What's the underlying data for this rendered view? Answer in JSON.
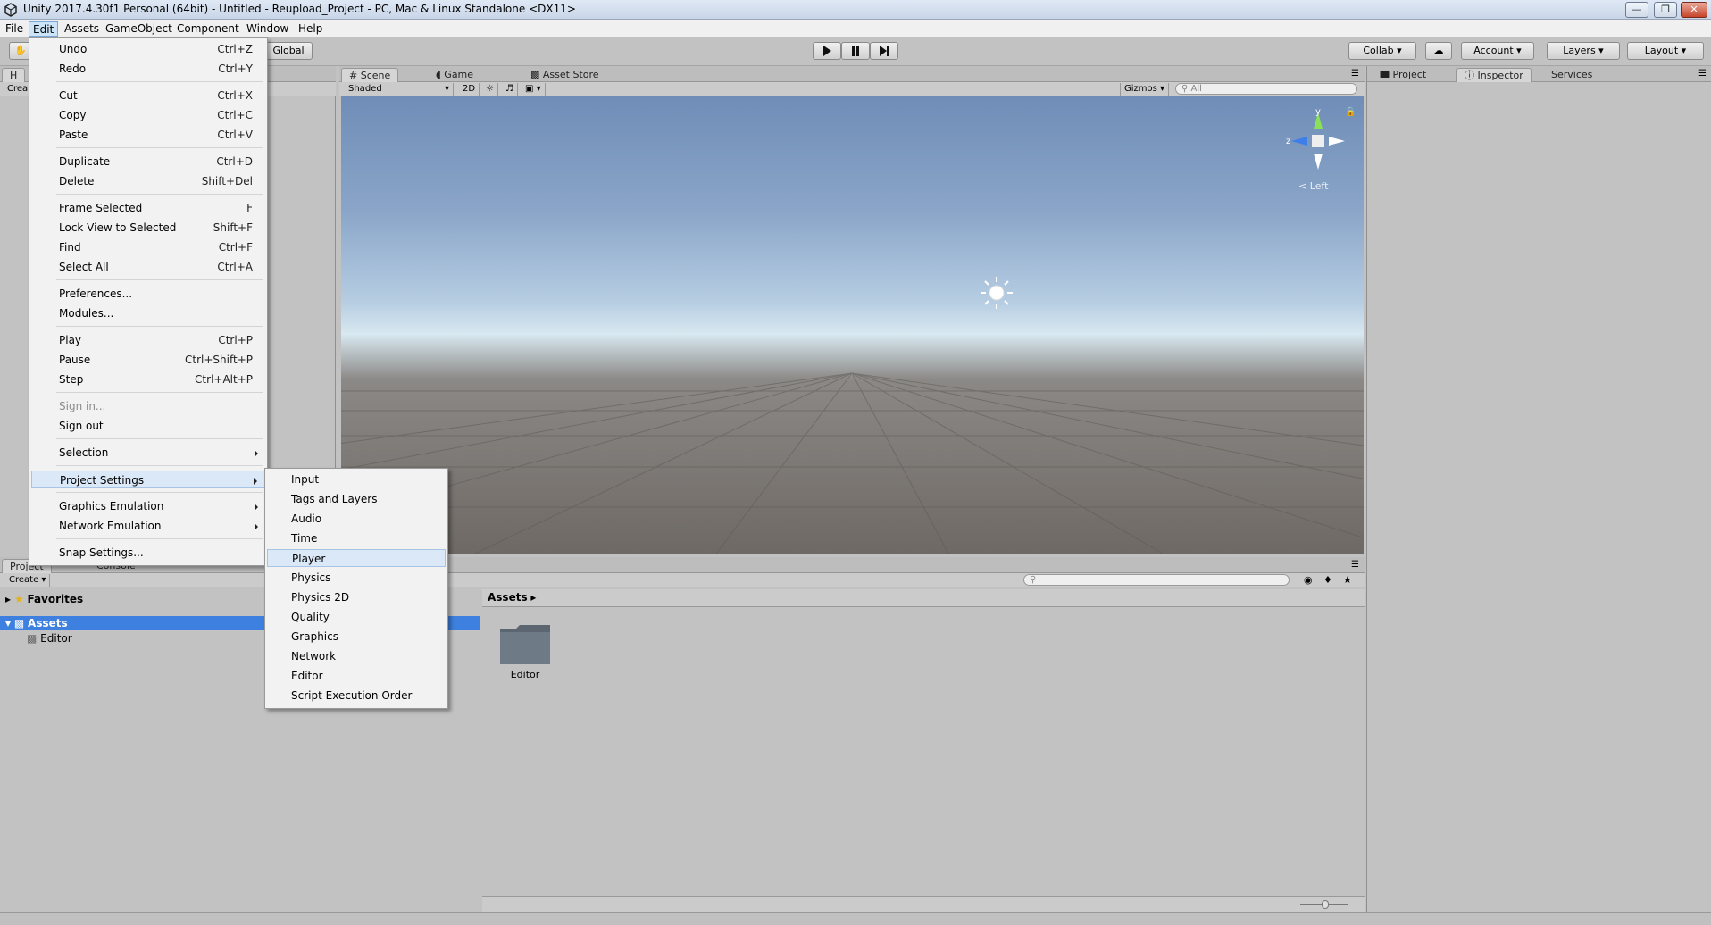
{
  "window": {
    "title": "Unity 2017.4.30f1 Personal (64bit) - Untitled - Reupload_Project - PC, Mac & Linux Standalone <DX11>"
  },
  "menubar": {
    "items": [
      "File",
      "Edit",
      "Assets",
      "GameObject",
      "Component",
      "Window",
      "Help"
    ]
  },
  "toolbar": {
    "global_label": "Global",
    "collab_label": "Collab",
    "account_label": "Account",
    "layers_label": "Layers",
    "layout_label": "Layout"
  },
  "scene_tabs": [
    "Scene",
    "Game",
    "Asset Store"
  ],
  "scene_toolbar": {
    "shading": "Shaded",
    "mode_2d": "2D",
    "gizmos": "Gizmos",
    "search_placeholder": "All"
  },
  "gizmo": {
    "label": "< Left",
    "y_axis": "y",
    "z_axis": "z"
  },
  "right_tabs": [
    "Project",
    "Inspector",
    "Services"
  ],
  "hierarchy": {
    "tab": "H",
    "create": "Crea"
  },
  "edit_menu": [
    {
      "label": "Undo",
      "shortcut": "Ctrl+Z"
    },
    {
      "label": "Redo",
      "shortcut": "Ctrl+Y"
    },
    {
      "label": "Cut",
      "shortcut": "Ctrl+X"
    },
    {
      "label": "Copy",
      "shortcut": "Ctrl+C"
    },
    {
      "label": "Paste",
      "shortcut": "Ctrl+V"
    },
    {
      "label": "Duplicate",
      "shortcut": "Ctrl+D"
    },
    {
      "label": "Delete",
      "shortcut": "Shift+Del"
    },
    {
      "label": "Frame Selected",
      "shortcut": "F"
    },
    {
      "label": "Lock View to Selected",
      "shortcut": "Shift+F"
    },
    {
      "label": "Find",
      "shortcut": "Ctrl+F"
    },
    {
      "label": "Select All",
      "shortcut": "Ctrl+A"
    },
    {
      "label": "Preferences...",
      "shortcut": ""
    },
    {
      "label": "Modules...",
      "shortcut": ""
    },
    {
      "label": "Play",
      "shortcut": "Ctrl+P"
    },
    {
      "label": "Pause",
      "shortcut": "Ctrl+Shift+P"
    },
    {
      "label": "Step",
      "shortcut": "Ctrl+Alt+P"
    },
    {
      "label": "Sign in...",
      "shortcut": ""
    },
    {
      "label": "Sign out",
      "shortcut": ""
    },
    {
      "label": "Selection",
      "shortcut": ""
    },
    {
      "label": "Project Settings",
      "shortcut": ""
    },
    {
      "label": "Graphics Emulation",
      "shortcut": ""
    },
    {
      "label": "Network Emulation",
      "shortcut": ""
    },
    {
      "label": "Snap Settings...",
      "shortcut": ""
    }
  ],
  "project_settings_menu": [
    "Input",
    "Tags and Layers",
    "Audio",
    "Time",
    "Player",
    "Physics",
    "Physics 2D",
    "Quality",
    "Graphics",
    "Network",
    "Editor",
    "Script Execution Order"
  ],
  "bottom_tabs": [
    "Project",
    "Console"
  ],
  "project_panel": {
    "create": "Create",
    "favorites": "Favorites",
    "assets": "Assets",
    "editor_folder": "Editor",
    "breadcrumb": "Assets",
    "grid_item": "Editor"
  }
}
